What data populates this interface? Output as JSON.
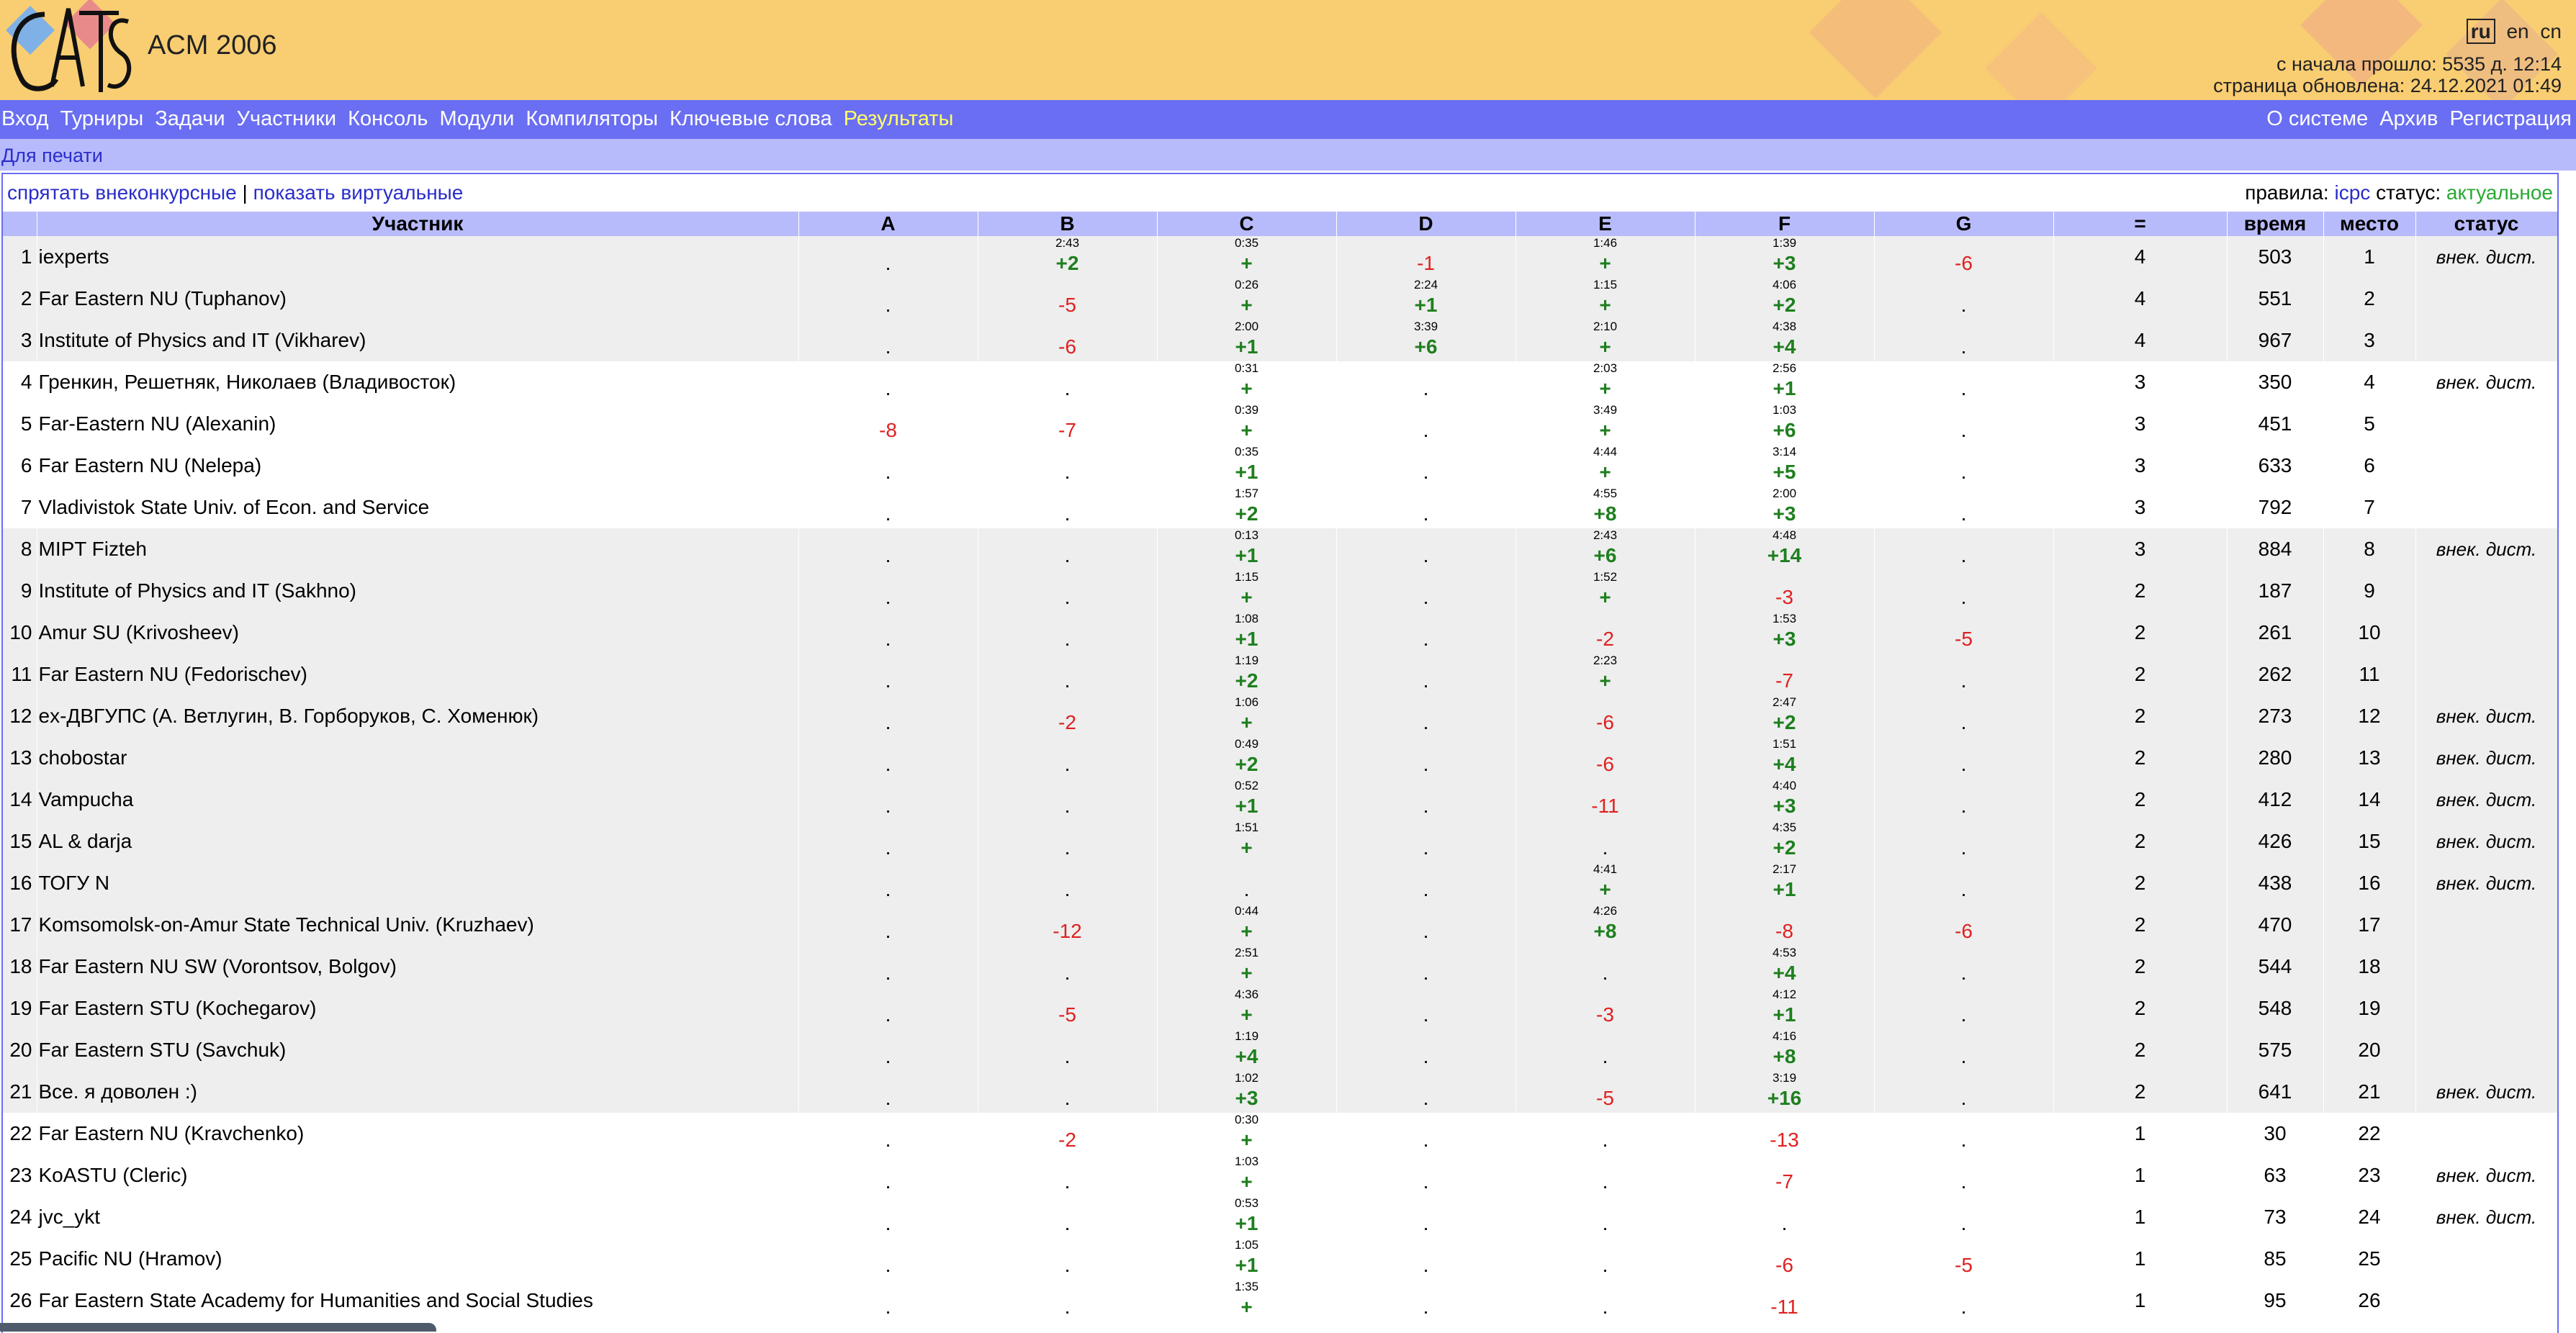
{
  "header": {
    "title": "ACM 2006",
    "logo_text": "CATS",
    "languages": [
      "ru",
      "en",
      "cn"
    ],
    "current_language": "ru",
    "elapsed": "с начала прошло: 5535 д. 12:14",
    "updated": "страница обновлена: 24.12.2021 01:49"
  },
  "menu": {
    "left": [
      "Вход",
      "Турниры",
      "Задачи",
      "Участники",
      "Консоль",
      "Модули",
      "Компиляторы",
      "Ключевые слова",
      "Результаты"
    ],
    "active": "Результаты",
    "right": [
      "О системе",
      "Архив",
      "Регистрация"
    ]
  },
  "submenu": {
    "print": "Для печати"
  },
  "filters": {
    "hide_ooc": "спрятать внеконкурсные",
    "separator": "|",
    "show_virtual": "показать виртуальные"
  },
  "rules": {
    "rules_label": "правила:",
    "rules_value": "icpc",
    "status_label": "статус:",
    "status_value": "актуальное"
  },
  "columns": {
    "participant": "Участник",
    "problems": [
      "A",
      "B",
      "C",
      "D",
      "E",
      "F",
      "G"
    ],
    "solved": "=",
    "time": "время",
    "place": "место",
    "status": "статус"
  },
  "rows": [
    {
      "n": "1",
      "name": "iexperts",
      "cells": [
        [
          ".",
          ""
        ],
        [
          "+2",
          "2:43"
        ],
        [
          "+",
          "0:35"
        ],
        [
          "-1",
          ""
        ],
        [
          "+",
          "1:46"
        ],
        [
          "+3",
          "1:39"
        ],
        [
          "-6",
          ""
        ]
      ],
      "solved": "4",
      "time": "503",
      "place": "1",
      "status": "внек. дист."
    },
    {
      "n": "2",
      "name": "Far Eastern NU (Tuphanov)",
      "cells": [
        [
          ".",
          ""
        ],
        [
          "-5",
          ""
        ],
        [
          "+",
          "0:26"
        ],
        [
          "+1",
          "2:24"
        ],
        [
          "+",
          "1:15"
        ],
        [
          "+2",
          "4:06"
        ],
        [
          ".",
          ""
        ]
      ],
      "solved": "4",
      "time": "551",
      "place": "2",
      "status": ""
    },
    {
      "n": "3",
      "name": "Institute of Physics and IT (Vikharev)",
      "cells": [
        [
          ".",
          ""
        ],
        [
          "-6",
          ""
        ],
        [
          "+1",
          "2:00"
        ],
        [
          "+6",
          "3:39"
        ],
        [
          "+",
          "2:10"
        ],
        [
          "+4",
          "4:38"
        ],
        [
          ".",
          ""
        ]
      ],
      "solved": "4",
      "time": "967",
      "place": "3",
      "status": ""
    },
    {
      "n": "4",
      "name": "Гренкин, Решетняк, Николаев (Владивосток)",
      "cells": [
        [
          ".",
          ""
        ],
        [
          ".",
          ""
        ],
        [
          "+",
          "0:31"
        ],
        [
          ".",
          ""
        ],
        [
          "+",
          "2:03"
        ],
        [
          "+1",
          "2:56"
        ],
        [
          ".",
          ""
        ]
      ],
      "solved": "3",
      "time": "350",
      "place": "4",
      "status": "внек. дист."
    },
    {
      "n": "5",
      "name": "Far-Eastern NU (Alexanin)",
      "cells": [
        [
          "-8",
          ""
        ],
        [
          "-7",
          ""
        ],
        [
          "+",
          "0:39"
        ],
        [
          ".",
          ""
        ],
        [
          "+",
          "3:49"
        ],
        [
          "+6",
          "1:03"
        ],
        [
          ".",
          ""
        ]
      ],
      "solved": "3",
      "time": "451",
      "place": "5",
      "status": ""
    },
    {
      "n": "6",
      "name": "Far Eastern NU (Nelepa)",
      "cells": [
        [
          ".",
          ""
        ],
        [
          ".",
          ""
        ],
        [
          "+1",
          "0:35"
        ],
        [
          ".",
          ""
        ],
        [
          "+",
          "4:44"
        ],
        [
          "+5",
          "3:14"
        ],
        [
          ".",
          ""
        ]
      ],
      "solved": "3",
      "time": "633",
      "place": "6",
      "status": ""
    },
    {
      "n": "7",
      "name": "Vladivistok State Univ. of Econ. and Service",
      "cells": [
        [
          ".",
          ""
        ],
        [
          ".",
          ""
        ],
        [
          "+2",
          "1:57"
        ],
        [
          ".",
          ""
        ],
        [
          "+8",
          "4:55"
        ],
        [
          "+3",
          "2:00"
        ],
        [
          ".",
          ""
        ]
      ],
      "solved": "3",
      "time": "792",
      "place": "7",
      "status": ""
    },
    {
      "n": "8",
      "name": "MIPT Fizteh",
      "cells": [
        [
          ".",
          ""
        ],
        [
          ".",
          ""
        ],
        [
          "+1",
          "0:13"
        ],
        [
          ".",
          ""
        ],
        [
          "+6",
          "2:43"
        ],
        [
          "+14",
          "4:48"
        ],
        [
          ".",
          ""
        ]
      ],
      "solved": "3",
      "time": "884",
      "place": "8",
      "status": "внек. дист."
    },
    {
      "n": "9",
      "name": "Institute of Physics and IT (Sakhno)",
      "cells": [
        [
          ".",
          ""
        ],
        [
          ".",
          ""
        ],
        [
          "+",
          "1:15"
        ],
        [
          ".",
          ""
        ],
        [
          "+",
          "1:52"
        ],
        [
          "-3",
          ""
        ],
        [
          ".",
          ""
        ]
      ],
      "solved": "2",
      "time": "187",
      "place": "9",
      "status": ""
    },
    {
      "n": "10",
      "name": "Amur SU (Krivosheev)",
      "cells": [
        [
          ".",
          ""
        ],
        [
          ".",
          ""
        ],
        [
          "+1",
          "1:08"
        ],
        [
          ".",
          ""
        ],
        [
          "-2",
          ""
        ],
        [
          "+3",
          "1:53"
        ],
        [
          "-5",
          ""
        ]
      ],
      "solved": "2",
      "time": "261",
      "place": "10",
      "status": ""
    },
    {
      "n": "11",
      "name": "Far Eastern NU (Fedorischev)",
      "cells": [
        [
          ".",
          ""
        ],
        [
          ".",
          ""
        ],
        [
          "+2",
          "1:19"
        ],
        [
          ".",
          ""
        ],
        [
          "+",
          "2:23"
        ],
        [
          "-7",
          ""
        ],
        [
          ".",
          ""
        ]
      ],
      "solved": "2",
      "time": "262",
      "place": "11",
      "status": ""
    },
    {
      "n": "12",
      "name": "ex-ДВГУПС (А. Ветлугин, В. Горборуков, С. Хоменюк)",
      "cells": [
        [
          ".",
          ""
        ],
        [
          "-2",
          ""
        ],
        [
          "+",
          "1:06"
        ],
        [
          ".",
          ""
        ],
        [
          "-6",
          ""
        ],
        [
          "+2",
          "2:47"
        ],
        [
          ".",
          ""
        ]
      ],
      "solved": "2",
      "time": "273",
      "place": "12",
      "status": "внек. дист."
    },
    {
      "n": "13",
      "name": "chobostar",
      "cells": [
        [
          ".",
          ""
        ],
        [
          ".",
          ""
        ],
        [
          "+2",
          "0:49"
        ],
        [
          ".",
          ""
        ],
        [
          "-6",
          ""
        ],
        [
          "+4",
          "1:51"
        ],
        [
          ".",
          ""
        ]
      ],
      "solved": "2",
      "time": "280",
      "place": "13",
      "status": "внек. дист."
    },
    {
      "n": "14",
      "name": "Vampucha",
      "cells": [
        [
          ".",
          ""
        ],
        [
          ".",
          ""
        ],
        [
          "+1",
          "0:52"
        ],
        [
          ".",
          ""
        ],
        [
          "-11",
          ""
        ],
        [
          "+3",
          "4:40"
        ],
        [
          ".",
          ""
        ]
      ],
      "solved": "2",
      "time": "412",
      "place": "14",
      "status": "внек. дист."
    },
    {
      "n": "15",
      "name": "AL & darja",
      "cells": [
        [
          ".",
          ""
        ],
        [
          ".",
          ""
        ],
        [
          "+",
          "1:51"
        ],
        [
          ".",
          ""
        ],
        [
          ".",
          ""
        ],
        [
          "+2",
          "4:35"
        ],
        [
          ".",
          ""
        ]
      ],
      "solved": "2",
      "time": "426",
      "place": "15",
      "status": "внек. дист."
    },
    {
      "n": "16",
      "name": "ТОГУ N",
      "cells": [
        [
          ".",
          ""
        ],
        [
          ".",
          ""
        ],
        [
          ".",
          ""
        ],
        [
          ".",
          ""
        ],
        [
          "+",
          "4:41"
        ],
        [
          "+1",
          "2:17"
        ],
        [
          ".",
          ""
        ]
      ],
      "solved": "2",
      "time": "438",
      "place": "16",
      "status": "внек. дист."
    },
    {
      "n": "17",
      "name": "Komsomolsk-on-Amur State Technical Univ. (Kruzhaev)",
      "cells": [
        [
          ".",
          ""
        ],
        [
          "-12",
          ""
        ],
        [
          "+",
          "0:44"
        ],
        [
          ".",
          ""
        ],
        [
          "+8",
          "4:26"
        ],
        [
          "-8",
          ""
        ],
        [
          "-6",
          ""
        ]
      ],
      "solved": "2",
      "time": "470",
      "place": "17",
      "status": ""
    },
    {
      "n": "18",
      "name": "Far Eastern NU SW (Vorontsov, Bolgov)",
      "cells": [
        [
          ".",
          ""
        ],
        [
          ".",
          ""
        ],
        [
          "+",
          "2:51"
        ],
        [
          ".",
          ""
        ],
        [
          ".",
          ""
        ],
        [
          "+4",
          "4:53"
        ],
        [
          ".",
          ""
        ]
      ],
      "solved": "2",
      "time": "544",
      "place": "18",
      "status": ""
    },
    {
      "n": "19",
      "name": "Far Eastern STU (Kochegarov)",
      "cells": [
        [
          ".",
          ""
        ],
        [
          "-5",
          ""
        ],
        [
          "+",
          "4:36"
        ],
        [
          ".",
          ""
        ],
        [
          "-3",
          ""
        ],
        [
          "+1",
          "4:12"
        ],
        [
          ".",
          ""
        ]
      ],
      "solved": "2",
      "time": "548",
      "place": "19",
      "status": ""
    },
    {
      "n": "20",
      "name": "Far Eastern STU (Savchuk)",
      "cells": [
        [
          ".",
          ""
        ],
        [
          ".",
          ""
        ],
        [
          "+4",
          "1:19"
        ],
        [
          ".",
          ""
        ],
        [
          ".",
          ""
        ],
        [
          "+8",
          "4:16"
        ],
        [
          ".",
          ""
        ]
      ],
      "solved": "2",
      "time": "575",
      "place": "20",
      "status": ""
    },
    {
      "n": "21",
      "name": "Все. я доволен :)",
      "cells": [
        [
          ".",
          ""
        ],
        [
          ".",
          ""
        ],
        [
          "+3",
          "1:02"
        ],
        [
          ".",
          ""
        ],
        [
          "-5",
          ""
        ],
        [
          "+16",
          "3:19"
        ],
        [
          ".",
          ""
        ]
      ],
      "solved": "2",
      "time": "641",
      "place": "21",
      "status": "внек. дист."
    },
    {
      "n": "22",
      "name": "Far Eastern NU (Kravchenko)",
      "cells": [
        [
          ".",
          ""
        ],
        [
          "-2",
          ""
        ],
        [
          "+",
          "0:30"
        ],
        [
          ".",
          ""
        ],
        [
          ".",
          ""
        ],
        [
          "-13",
          ""
        ],
        [
          ".",
          ""
        ]
      ],
      "solved": "1",
      "time": "30",
      "place": "22",
      "status": ""
    },
    {
      "n": "23",
      "name": "KoASTU (Cleric)",
      "cells": [
        [
          ".",
          ""
        ],
        [
          ".",
          ""
        ],
        [
          "+",
          "1:03"
        ],
        [
          ".",
          ""
        ],
        [
          ".",
          ""
        ],
        [
          "-7",
          ""
        ],
        [
          ".",
          ""
        ]
      ],
      "solved": "1",
      "time": "63",
      "place": "23",
      "status": "внек. дист."
    },
    {
      "n": "24",
      "name": "jvc_ykt",
      "cells": [
        [
          ".",
          ""
        ],
        [
          ".",
          ""
        ],
        [
          "+1",
          "0:53"
        ],
        [
          ".",
          ""
        ],
        [
          ".",
          ""
        ],
        [
          ".",
          ""
        ],
        [
          ".",
          ""
        ]
      ],
      "solved": "1",
      "time": "73",
      "place": "24",
      "status": "внек. дист."
    },
    {
      "n": "25",
      "name": "Pacific NU (Hramov)",
      "cells": [
        [
          ".",
          ""
        ],
        [
          ".",
          ""
        ],
        [
          "+1",
          "1:05"
        ],
        [
          ".",
          ""
        ],
        [
          ".",
          ""
        ],
        [
          "-6",
          ""
        ],
        [
          "-5",
          ""
        ]
      ],
      "solved": "1",
      "time": "85",
      "place": "25",
      "status": ""
    },
    {
      "n": "26",
      "name": "Far Eastern State Academy for Humanities and Social Studies",
      "cells": [
        [
          ".",
          ""
        ],
        [
          ".",
          ""
        ],
        [
          "+",
          "1:35"
        ],
        [
          ".",
          ""
        ],
        [
          ".",
          ""
        ],
        [
          "-11",
          ""
        ],
        [
          ".",
          ""
        ]
      ],
      "solved": "1",
      "time": "95",
      "place": "26",
      "status": ""
    }
  ],
  "colors": {
    "header_bg": "#f9cd72",
    "menu_bg": "#6a6ef2",
    "submenu_bg": "#b8bbfb",
    "accepted": "#1e7f1e",
    "rejected": "#e02020",
    "active_menu": "#ffff66"
  }
}
